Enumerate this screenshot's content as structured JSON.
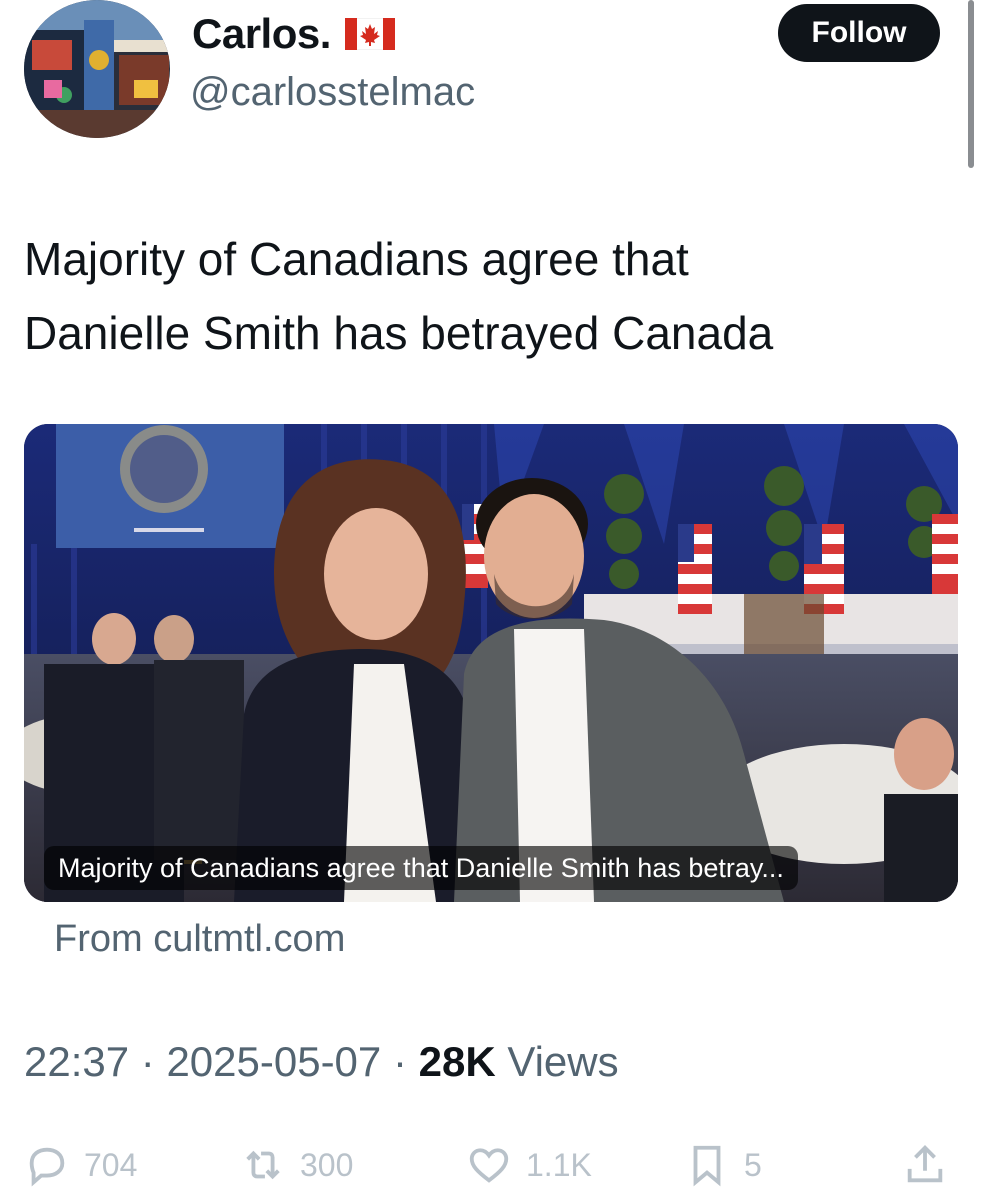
{
  "profile": {
    "display_name": "Carlos.",
    "flag_emoji": "🇨🇦",
    "handle": "@carlosstelmac",
    "follow_label": "Follow"
  },
  "tweet": {
    "text_line1": "Majority of Canadians agree that",
    "text_line2": "Danielle Smith has betrayed Canada"
  },
  "card": {
    "caption": "Majority of Canadians agree that Danielle Smith has betray...",
    "source": "From cultmtl.com"
  },
  "meta": {
    "time": "22:37",
    "sep1": " · ",
    "date": "2025-05-07",
    "sep2": " · ",
    "views_count": "28K",
    "views_label": " Views"
  },
  "actions": {
    "replies": "704",
    "reposts": "300",
    "likes": "1.1K",
    "bookmarks": "5"
  },
  "colors": {
    "text": "#0f1419",
    "secondary": "#536471",
    "action_faded": "#b9c2ca",
    "follow_bg": "#0f1419"
  }
}
